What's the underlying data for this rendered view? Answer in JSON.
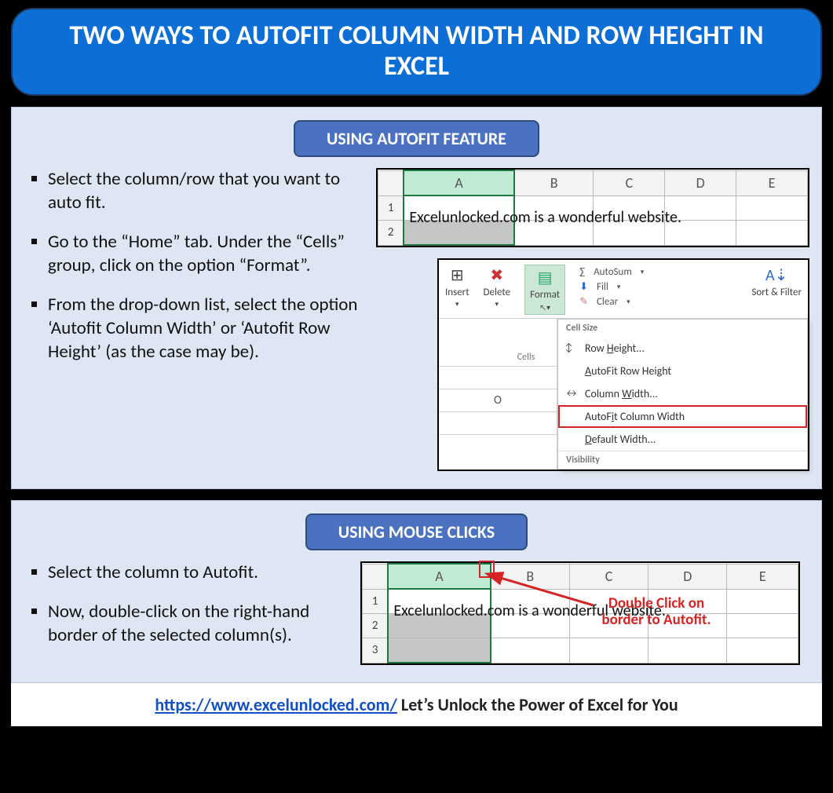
{
  "title": "TWO WAYS TO AUTOFIT COLUMN WIDTH AND ROW HEIGHT IN EXCEL",
  "section1": {
    "heading": "USING AUTOFIT FEATURE",
    "steps": [
      "Select the column/row that you want to auto fit.",
      "Go to the “Home” tab. Under the “Cells” group, click on the option “Format”.",
      "From the drop-down list, select the option ‘Autofit Column Width’ or ‘Autofit Row Height’ (as the case may be)."
    ],
    "grid": {
      "cols": [
        "A",
        "B",
        "C",
        "D",
        "E"
      ],
      "rows": [
        "1",
        "2"
      ],
      "cell_text": "Excelunlocked.com is a wonderful website."
    },
    "ribbon": {
      "buttons": {
        "insert": "Insert",
        "delete": "Delete",
        "format": "Format"
      },
      "cells_label": "Cells",
      "side": {
        "autosum": "AutoSum",
        "fill": "Fill",
        "clear": "Clear"
      },
      "sort_filter": "Sort & Filter",
      "dropdown": {
        "section1": "Cell Size",
        "row_height": "Row Height...",
        "autofit_row": "AutoFit Row Height",
        "col_width": "Column Width...",
        "autofit_col": "AutoFit Column Width",
        "default_width": "Default Width...",
        "section2": "Visibility"
      },
      "col_label": "O"
    }
  },
  "section2": {
    "heading": "USING MOUSE CLICKS",
    "steps": [
      "Select the column to Autofit.",
      "Now, double-click on the right-hand border of the selected column(s)."
    ],
    "grid": {
      "cols": [
        "A",
        "B",
        "C",
        "D",
        "E"
      ],
      "rows": [
        "1",
        "2",
        "3"
      ],
      "cell_text": "Excelunlocked.com is a wonderful website."
    },
    "annotation_line1": "Double Click on",
    "annotation_line2": "border to Autofit."
  },
  "footer": {
    "link_text": "https://www.excelunlocked.com/",
    "tagline": "Let’s Unlock the Power of Excel for You"
  }
}
